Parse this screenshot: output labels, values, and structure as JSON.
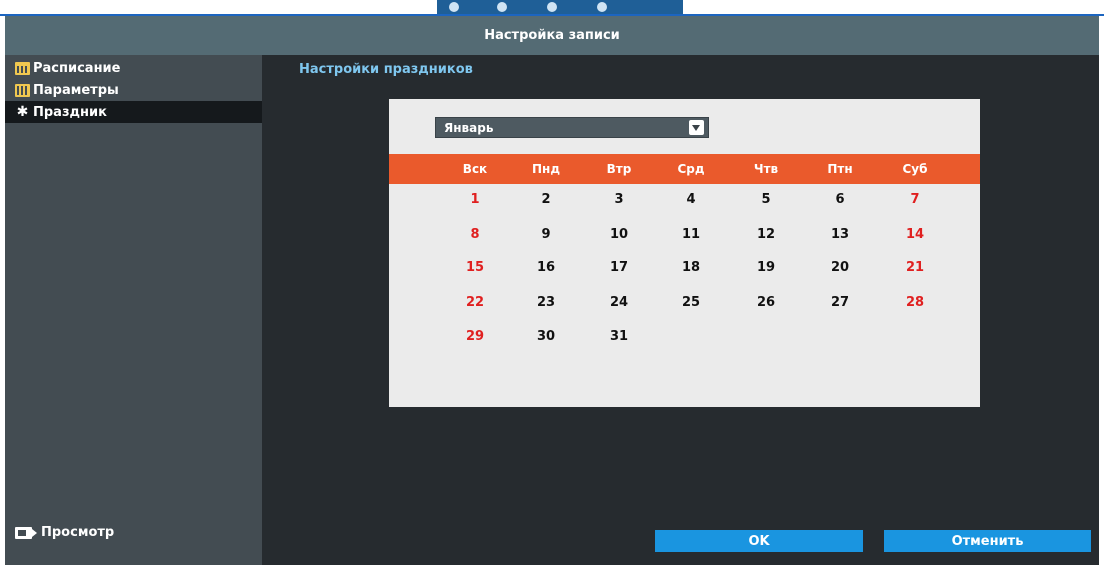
{
  "window": {
    "title": "Настройка записи"
  },
  "sidebar": {
    "items": [
      {
        "label": "Расписание",
        "icon": "calendar-icon",
        "active": false
      },
      {
        "label": "Параметры",
        "icon": "parameters-icon",
        "active": false
      },
      {
        "label": "Праздник",
        "icon": "palm-tree-icon",
        "active": true
      }
    ],
    "preview_label": "Просмотр",
    "preview_icon": "camera-icon"
  },
  "main": {
    "section_title": "Настройки праздников"
  },
  "calendar": {
    "month": "Январь",
    "weekdays": [
      "Вск",
      "Пнд",
      "Втр",
      "Срд",
      "Чтв",
      "Птн",
      "Суб"
    ],
    "weeks": [
      [
        "1",
        "2",
        "3",
        "4",
        "5",
        "6",
        "7"
      ],
      [
        "8",
        "9",
        "10",
        "11",
        "12",
        "13",
        "14"
      ],
      [
        "15",
        "16",
        "17",
        "18",
        "19",
        "20",
        "21"
      ],
      [
        "22",
        "23",
        "24",
        "25",
        "26",
        "27",
        "28"
      ],
      [
        "29",
        "30",
        "31"
      ]
    ],
    "weekend_color": "#e02020",
    "header_color": "#ea5a2c"
  },
  "buttons": {
    "ok": "OK",
    "cancel": "Отменить"
  },
  "colors": {
    "accent": "#1a95e0",
    "title_bar": "#546b74",
    "section_title": "#7fc7ef"
  }
}
